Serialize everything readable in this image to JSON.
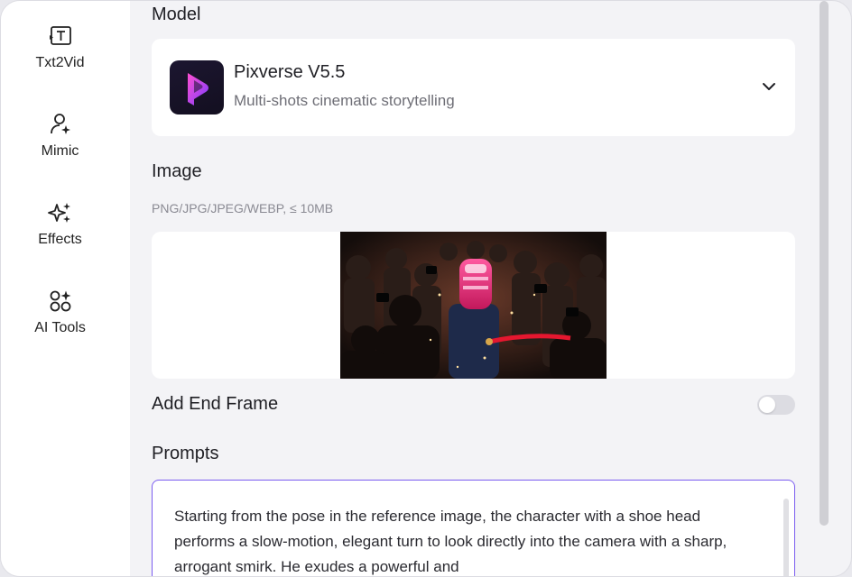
{
  "sidebar": {
    "items": [
      {
        "label": "Txt2Vid",
        "icon": "text-to-video-icon"
      },
      {
        "label": "Mimic",
        "icon": "person-sparkle-icon"
      },
      {
        "label": "Effects",
        "icon": "sparkles-icon"
      },
      {
        "label": "AI Tools",
        "icon": "tools-grid-icon"
      }
    ]
  },
  "model": {
    "section_label": "Model",
    "name": "Pixverse V5.5",
    "description": "Multi-shots cinematic storytelling",
    "logo_color": "#9b3cff"
  },
  "image": {
    "section_label": "Image",
    "formats": "PNG/JPG/JPEG/WEBP, ≤ 10MB"
  },
  "end_frame": {
    "label": "Add End Frame",
    "enabled": false
  },
  "prompts": {
    "section_label": "Prompts",
    "text": "Starting from the pose in the reference image, the character with a shoe head performs a slow-motion, elegant turn to look directly into the camera with a sharp, arrogant smirk. He exudes a powerful and"
  },
  "colors": {
    "accent": "#7a5cf0",
    "background": "#f3f3f6"
  }
}
